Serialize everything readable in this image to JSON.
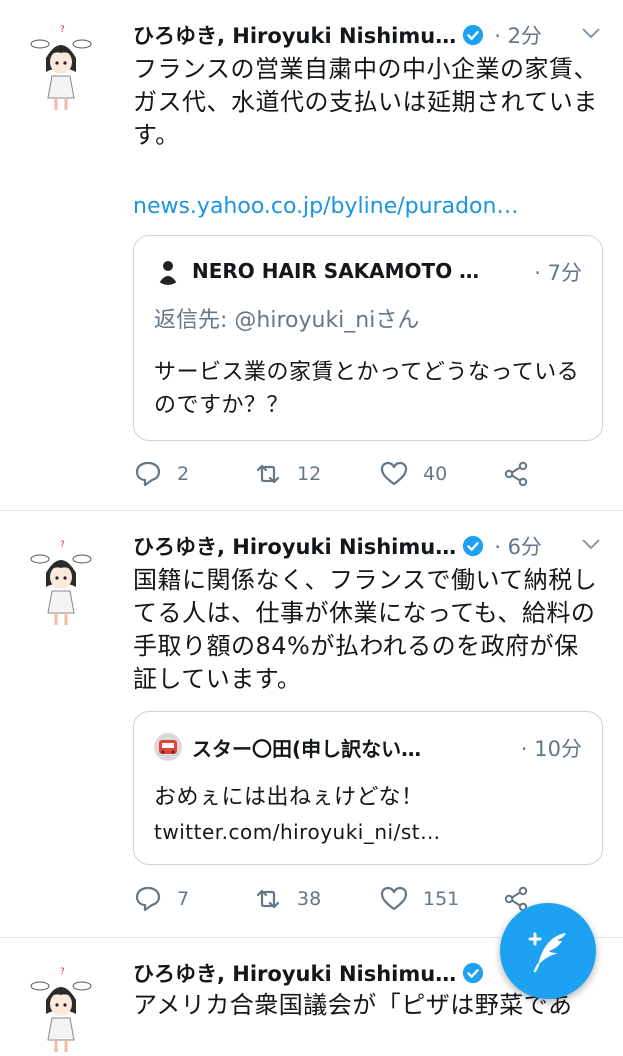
{
  "tweets": [
    {
      "author": "ひろゆき, Hiroyuki Nishimu…",
      "time": "· 2分",
      "text": "フランスの営業自粛中の中小企業の家賃、ガス代、水道代の支払いは延期されています。",
      "link": "news.yahoo.co.jp/byline/puradon…",
      "quote": {
        "author": "NERO HAIR SAKAMOTO …",
        "time": "· 7分",
        "reply": "返信先: @hiroyuki_niさん",
        "text": "サービス業の家賃とかってどうなっているのですか？？"
      },
      "replies": "2",
      "retweets": "12",
      "likes": "40"
    },
    {
      "author": "ひろゆき, Hiroyuki Nishimu…",
      "time": "· 6分",
      "text": "国籍に関係なく、フランスで働いて納税してる人は、仕事が休業になっても、給料の手取り額の84%が払われるのを政府が保証しています。",
      "quote": {
        "author": "スター〇田(申し訳ない…",
        "time": "· 10分",
        "text": "おめぇには出ねぇけどな！",
        "link": "twitter.com/hiroyuki_ni/st…"
      },
      "replies": "7",
      "retweets": "38",
      "likes": "151"
    },
    {
      "author": "ひろゆき, Hiroyuki Nishimu…",
      "text": "アメリカ合衆国議会が「ピザは野菜であ"
    }
  ],
  "colors": {
    "accent": "#1da1f2",
    "link": "#1b95e0",
    "muted": "#657786",
    "divider": "#e1e8ed"
  },
  "icons": [
    "reply-icon",
    "retweet-icon",
    "like-icon",
    "share-icon",
    "verified-icon",
    "compose-tweet-icon"
  ]
}
